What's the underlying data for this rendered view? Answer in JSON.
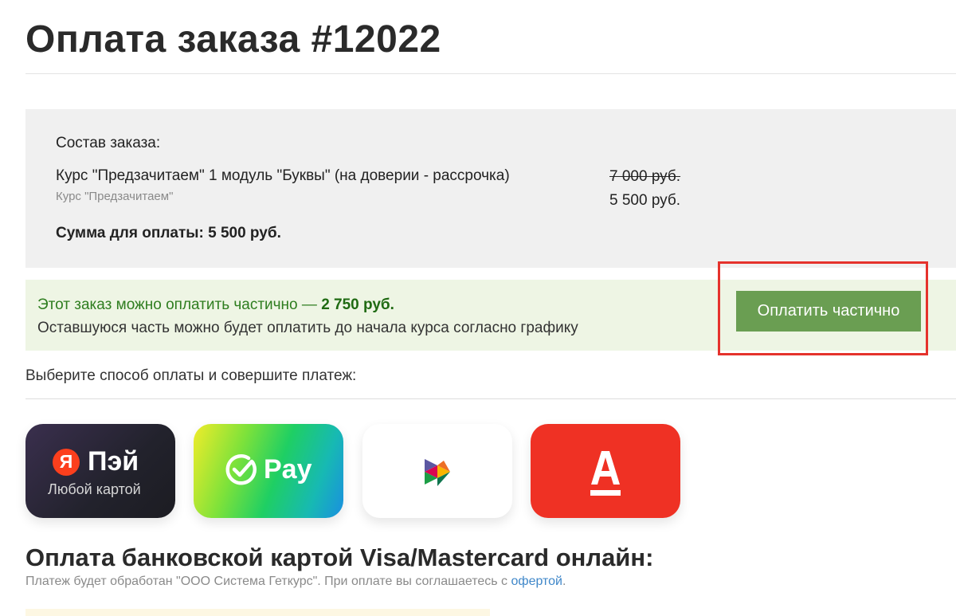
{
  "page": {
    "title": "Оплата заказа #12022"
  },
  "order": {
    "heading": "Состав заказа:",
    "item_name": "Курс \"Предзачитаем\" 1 модуль \"Буквы\" (на доверии - рассрочка)",
    "item_sub": "Курс \"Предзачитаем\"",
    "price_old": "7 000 руб.",
    "price_new": "5 500 руб.",
    "total": "Сумма для оплаты: 5 500 руб."
  },
  "partial": {
    "line1_text": "Этот заказ можно оплатить частично — ",
    "line1_amount": "2 750 руб.",
    "line2": "Оставшуюся часть можно будет оплатить до начала курса согласно графику",
    "button_label": "Оплатить частично"
  },
  "payment": {
    "choose_text": "Выберите способ оплаты и совершите платеж:",
    "methods": [
      {
        "name": "Яндекс Пэй",
        "logo_letter": "Я",
        "logo_text": "Пэй",
        "subtitle": "Любой картой",
        "icon": "yandex-pay-icon"
      },
      {
        "name": "SberPay",
        "logo_text": "Pay",
        "icon": "sber-pay-icon"
      },
      {
        "name": "СБП",
        "icon": "sbp-icon"
      },
      {
        "name": "Альфа-Банк",
        "icon": "alfa-bank-icon",
        "logo_letter": "А"
      }
    ]
  },
  "card": {
    "heading": "Оплата банковской картой Visa/Mastercard онлайн:",
    "note_text": "Платеж будет обработан \"ООО Система Геткурс\". При оплате вы соглашаетесь с ",
    "offer_link": "офертой",
    "note_end": "."
  },
  "colors": {
    "accent_green": "#6a9e52",
    "highlight_red": "#e5322c",
    "link_blue": "#3f87c9"
  }
}
